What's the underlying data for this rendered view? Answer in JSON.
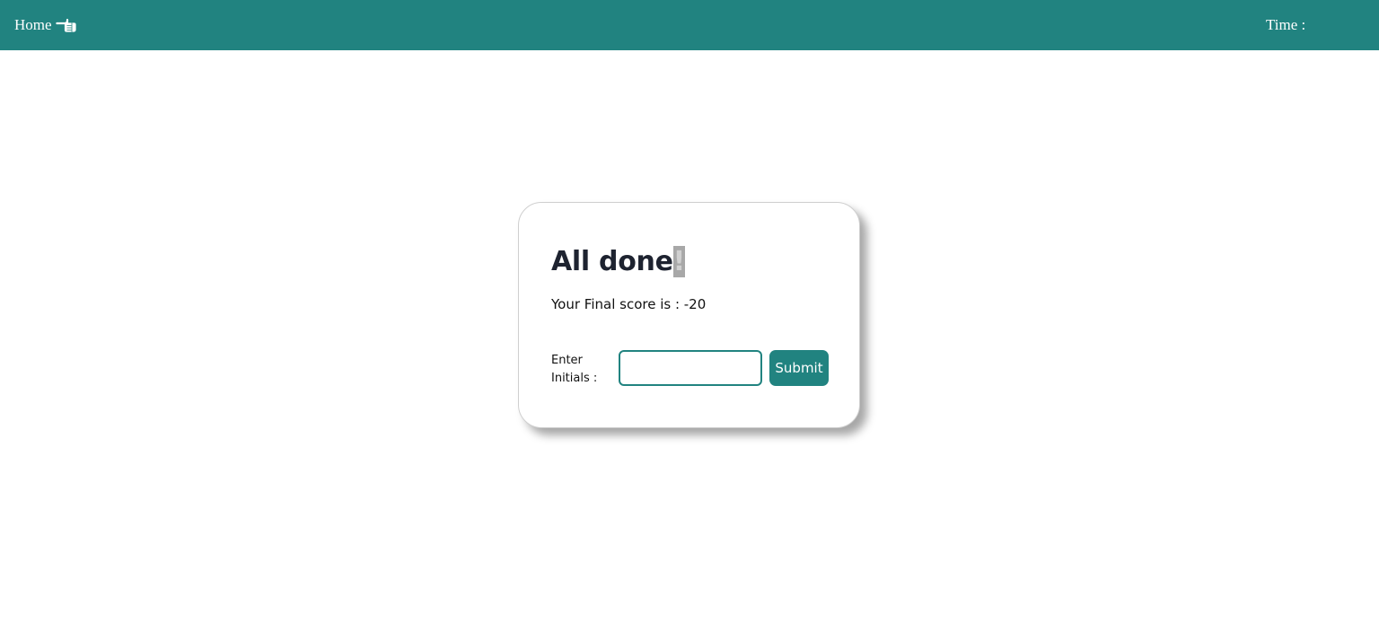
{
  "navbar": {
    "home_label": "Home",
    "home_icon": "pointing-hand-icon",
    "time_label": "Time :",
    "time_value": "",
    "background_color": "#218380"
  },
  "result_card": {
    "title_main": "All done",
    "title_highlight": "!",
    "score_text": "Your Final score is : -20",
    "initials_label": "Enter Initials :",
    "initials_value": "",
    "submit_label": "Submit"
  },
  "colors": {
    "accent": "#218380",
    "title": "#1e2330"
  }
}
